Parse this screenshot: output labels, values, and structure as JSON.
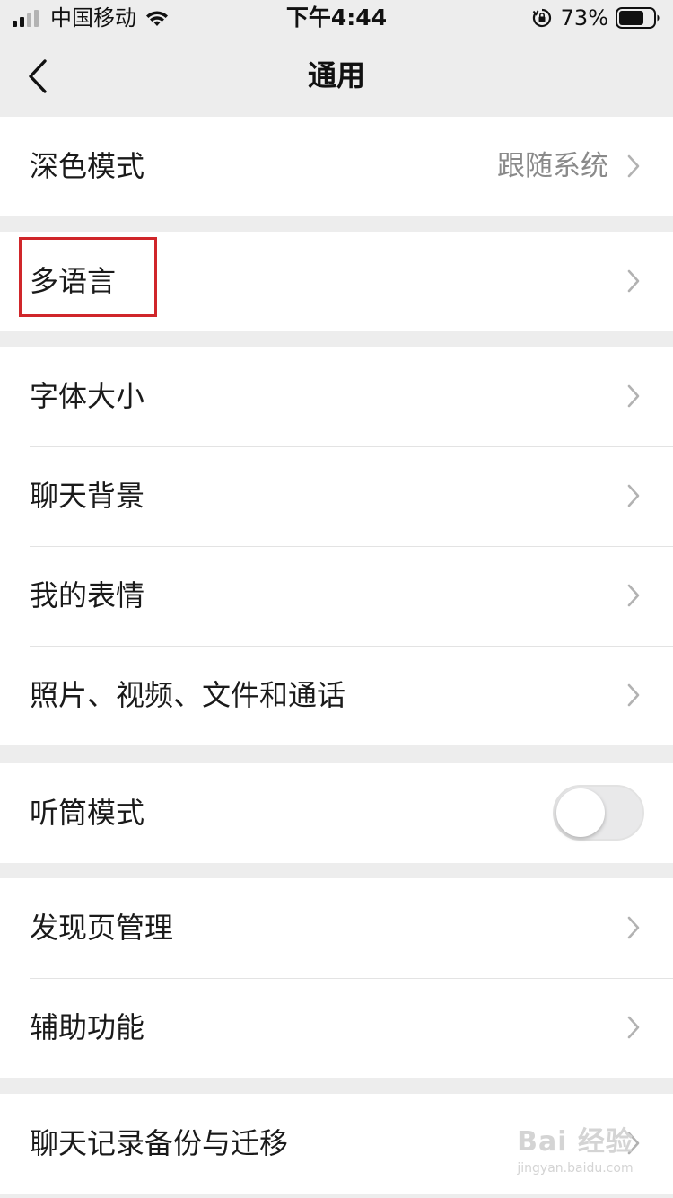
{
  "status_bar": {
    "carrier": "中国移动",
    "time": "下午4:44",
    "battery_percent": "73%",
    "battery_level": 0.73,
    "icons": [
      "signal-icon",
      "wifi-icon",
      "orientation-lock-icon",
      "battery-icon"
    ]
  },
  "nav": {
    "title": "通用",
    "back_icon": "chevron-left-icon"
  },
  "groups": {
    "dark_mode": {
      "label": "深色模式",
      "value": "跟随系统"
    },
    "language": {
      "label": "多语言"
    },
    "display": {
      "font_size": "字体大小",
      "chat_background": "聊天背景",
      "my_stickers": "我的表情",
      "media_files": "照片、视频、文件和通话"
    },
    "earpiece": {
      "label": "听筒模式",
      "toggle_on": false
    },
    "discover": {
      "discover_manage": "发现页管理",
      "accessibility": "辅助功能"
    },
    "backup": {
      "chat_backup": "聊天记录备份与迁移"
    }
  },
  "colors": {
    "background": "#ededed",
    "cell": "#ffffff",
    "highlight": "#d0262a",
    "secondary_text": "#8a8a8a"
  },
  "watermark": {
    "main": "Bai 经验",
    "sub": "jingyan.baidu.com"
  }
}
